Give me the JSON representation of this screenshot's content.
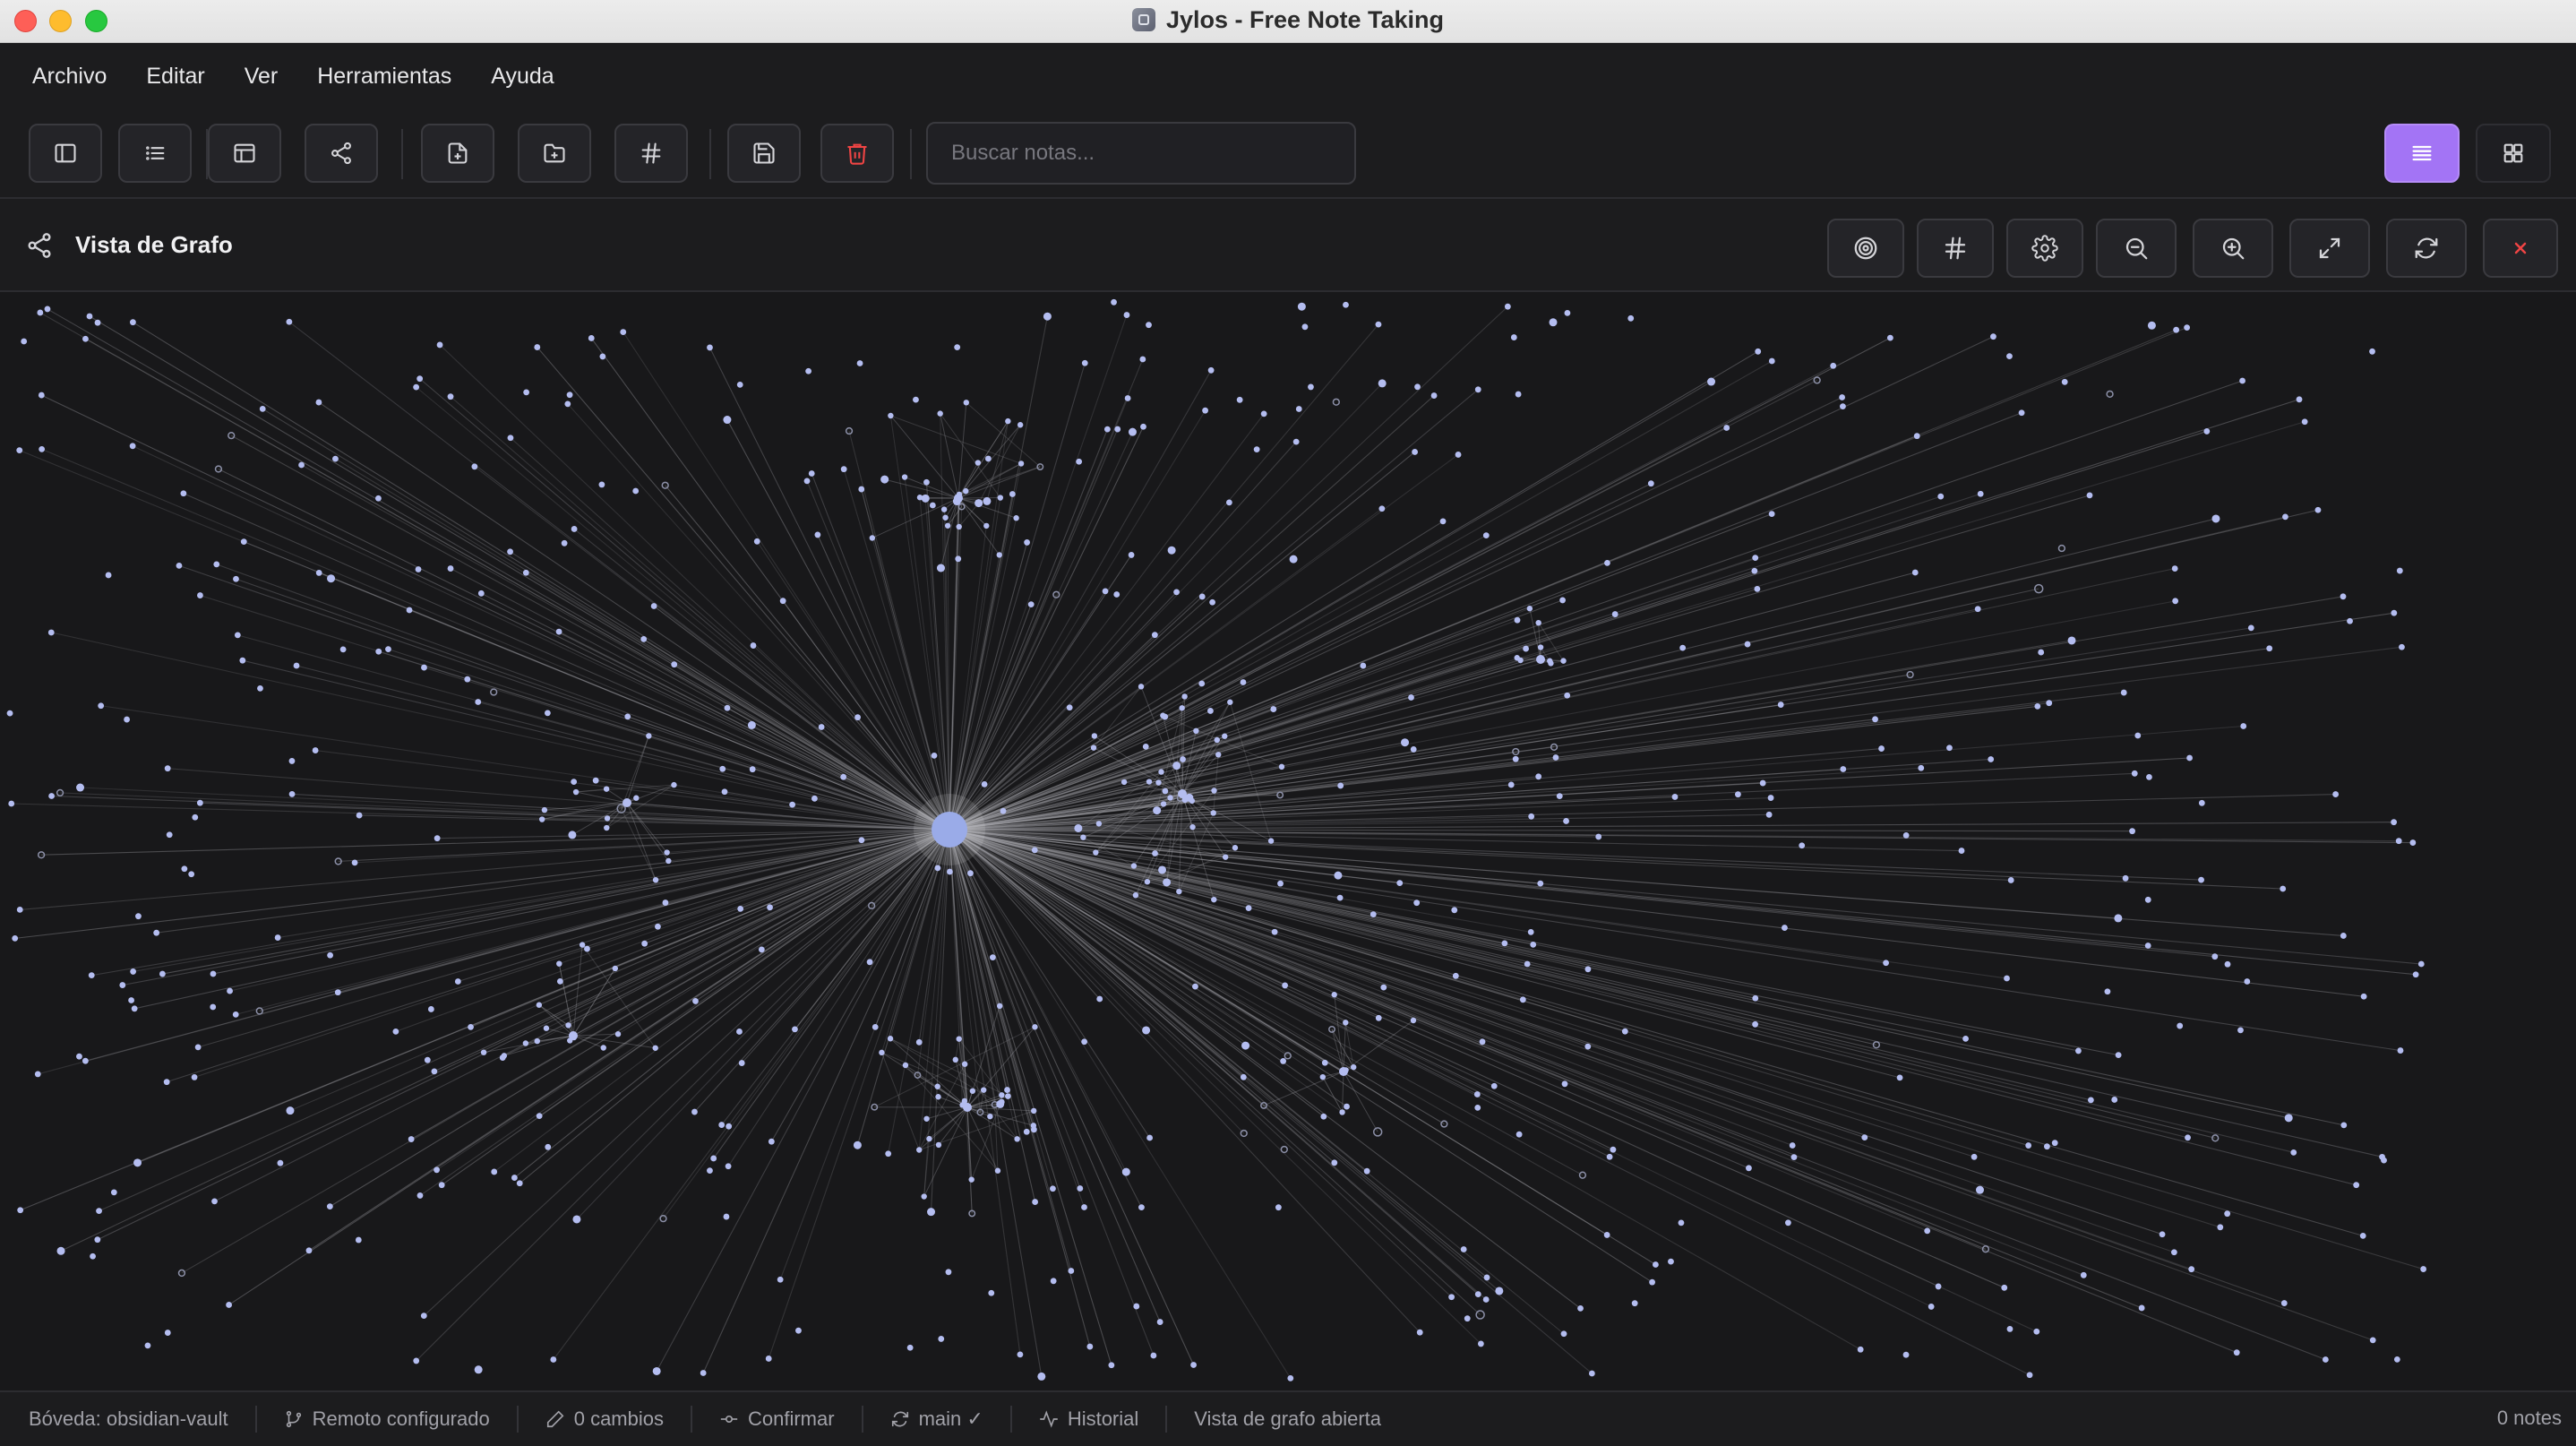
{
  "window": {
    "title": "Jylos - Free Note Taking"
  },
  "menu": {
    "items": [
      "Archivo",
      "Editar",
      "Ver",
      "Herramientas",
      "Ayuda"
    ]
  },
  "toolbar": {
    "buttons": [
      {
        "name": "toggle-sidebar",
        "icon": "sidebar-icon"
      },
      {
        "name": "outline",
        "icon": "list-icon"
      },
      {
        "name": "layout",
        "icon": "layout-icon"
      },
      {
        "name": "graph",
        "icon": "share-icon"
      },
      {
        "name": "new-note",
        "icon": "file-plus-icon"
      },
      {
        "name": "new-folder",
        "icon": "folder-plus-icon"
      },
      {
        "name": "tags",
        "icon": "hash-icon"
      },
      {
        "name": "save",
        "icon": "save-icon"
      },
      {
        "name": "delete",
        "icon": "trash-icon",
        "color": "#ef4444"
      }
    ],
    "search": {
      "placeholder": "Buscar notas...",
      "value": ""
    },
    "view_toggle": {
      "active": "list-view",
      "accent": "#a374f5"
    }
  },
  "graph_header": {
    "title": "Vista de Grafo",
    "icon": "share-icon",
    "controls": [
      "target-icon",
      "hash-icon",
      "settings-icon",
      "zoom-out-icon",
      "zoom-in-icon",
      "maximize-icon",
      "refresh-icon",
      "close-icon"
    ]
  },
  "graph": {
    "background": "#18181a",
    "node_color": "#b4bdf0",
    "hub_color": "#9aabe8",
    "edge_color": "#a8a8ae"
  },
  "statusbar": {
    "vault": "Bóveda: obsidian-vault",
    "remote": "Remoto configurado",
    "changes": "0 cambios",
    "commit": "Confirmar",
    "branch": "main ✓",
    "history": "Historial",
    "status": "Vista de grafo abierta",
    "notes_count": "0 notes"
  }
}
